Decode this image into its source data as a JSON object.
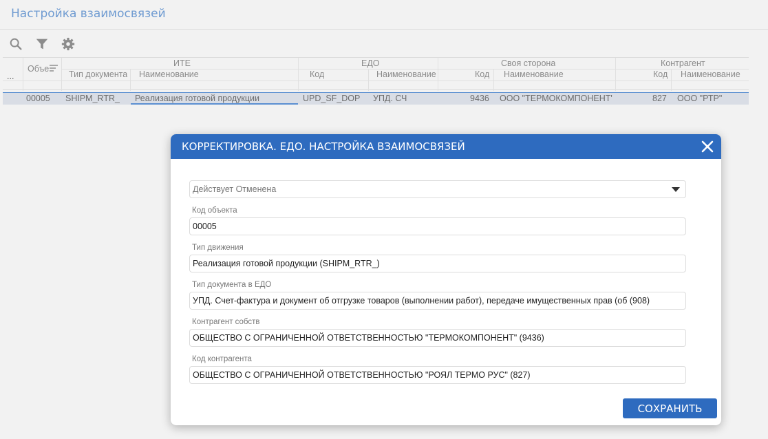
{
  "page": {
    "title": "Настройка взаимосвязей"
  },
  "toolbar": {
    "icons": [
      "search-icon",
      "filter-icon",
      "gear-icon"
    ]
  },
  "grid": {
    "groups": {
      "ite": "ИТЕ",
      "edo": "ЕДО",
      "own": "Своя сторона",
      "counterparty": "Контрагент"
    },
    "columns": {
      "more": "...",
      "object": "Объе",
      "doc_type": "Тип документа",
      "ite_name": "Наименование",
      "edo_code": "Код",
      "edo_name": "Наименование",
      "own_code": "Код",
      "own_name": "Наименование",
      "cp_code": "Код",
      "cp_name": "Наименование"
    },
    "rows": [
      {
        "object": "00005",
        "doc_type": "SHIPM_RTR_",
        "ite_name": "Реализация готовой продукции",
        "edo_code": "UPD_SF_DOP",
        "edo_name": "УПД. СЧ",
        "own_code": "9436",
        "own_name": "ООО \"ТЕРМОКОМПОНЕНТ'",
        "cp_code": "827",
        "cp_name": "ООО \"РТР\""
      }
    ]
  },
  "dialog": {
    "title": "КОРРЕКТИРОВКА. ЕДО. НАСТРОЙКА ВЗАИМОСВЯЗЕЙ",
    "status_select": {
      "value": "Действует Отменена"
    },
    "fields": [
      {
        "label": "Код объекта",
        "value": "00005"
      },
      {
        "label": "Тип движения",
        "value": "Реализация готовой продукции (SHIPM_RTR_)"
      },
      {
        "label": "Тип документа в ЕДО",
        "value": "УПД. Счет-фактура и документ об отгрузке товаров (выполнении работ), передаче имущественных прав (об (908)"
      },
      {
        "label": "Контрагент собств",
        "value": "ОБЩЕСТВО С ОГРАНИЧЕННОЙ ОТВЕТСТВЕННОСТЬЮ \"ТЕРМОКОМПОНЕНТ\" (9436)"
      },
      {
        "label": "Код контрагента",
        "value": "ОБЩЕСТВО С ОГРАНИЧЕННОЙ ОТВЕТСТВЕННОСТЬЮ \"РОЯЛ ТЕРМО РУС\" (827)"
      }
    ],
    "save_label": "СОХРАНИТЬ"
  },
  "colors": {
    "accent": "#2e6bbf",
    "title": "#6f9bd1",
    "selected_row": "#d9dde5"
  }
}
